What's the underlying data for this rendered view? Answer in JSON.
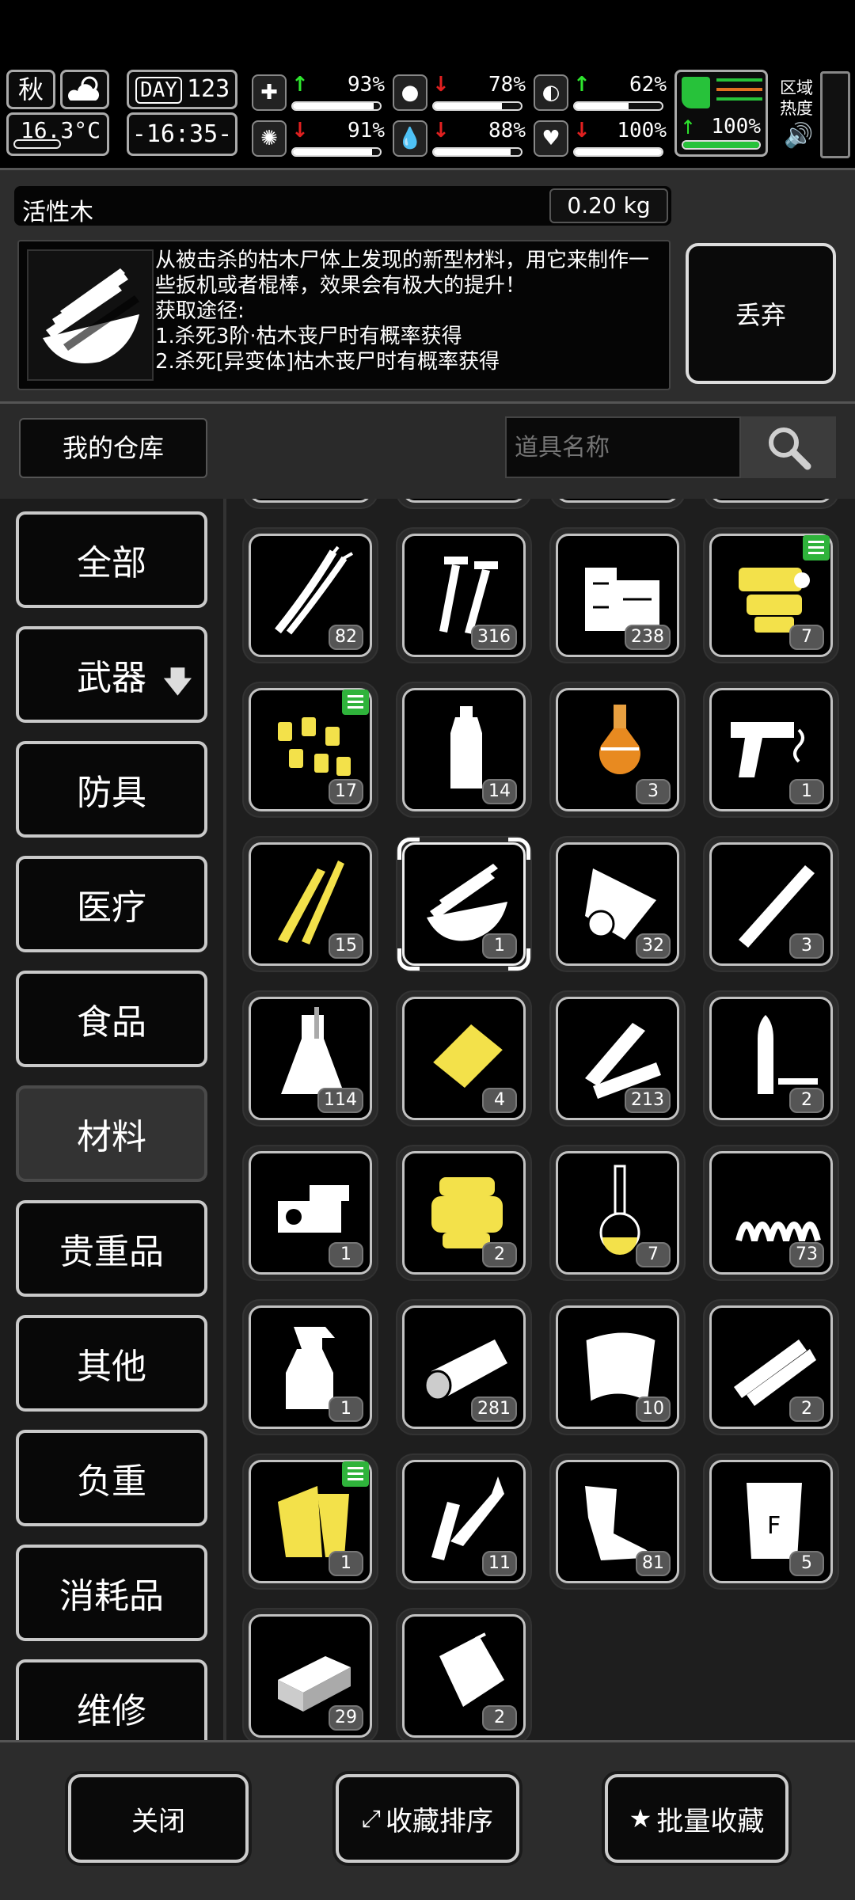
{
  "status": {
    "season": "秋",
    "temperature": "16.3°C",
    "day_label": "DAY",
    "day": "123",
    "time": "-16:35-",
    "stats": [
      {
        "icon": "medkit-icon",
        "glyph": "✚",
        "trend": "up",
        "value": "93%",
        "level": 0.93
      },
      {
        "icon": "stomach-icon",
        "glyph": "●",
        "trend": "down",
        "value": "78%",
        "level": 0.78
      },
      {
        "icon": "pill-icon",
        "glyph": "◐",
        "trend": "up",
        "value": "62%",
        "level": 0.62
      },
      {
        "icon": "brain-icon",
        "glyph": "✺",
        "trend": "down",
        "value": "91%",
        "level": 0.91
      },
      {
        "icon": "water-drop-icon",
        "glyph": "💧",
        "trend": "down",
        "value": "88%",
        "level": 0.88
      },
      {
        "icon": "heart-icon",
        "glyph": "♥",
        "trend": "down",
        "value": "100%",
        "level": 1.0
      }
    ],
    "stamina": {
      "icon": "boot-icon",
      "trend": "up",
      "value": "100%",
      "level": 1.0
    },
    "zone_label_1": "区域",
    "zone_label_2": "热度"
  },
  "item": {
    "name": "活性木",
    "weight": "0.20 kg",
    "description": "从被击杀的枯木尸体上发现的新型材料，用它来制作一些扳机或者棍棒，效果会有极大的提升！",
    "source_title": "获取途径:",
    "source_1": "1.杀死3阶·枯木丧尸时有概率获得",
    "source_2": "2.杀死[异变体]枯木丧尸时有概率获得",
    "discard_label": "丢弃"
  },
  "warehouse": {
    "title": "我的仓库",
    "search_placeholder": "道具名称"
  },
  "categories": [
    {
      "label": "全部",
      "active": false
    },
    {
      "label": "武器",
      "active": false,
      "arrow": true
    },
    {
      "label": "防具",
      "active": false
    },
    {
      "label": "医疗",
      "active": false
    },
    {
      "label": "食品",
      "active": false
    },
    {
      "label": "材料",
      "active": true
    },
    {
      "label": "贵重品",
      "active": false
    },
    {
      "label": "其他",
      "active": false
    },
    {
      "label": "负重",
      "active": false
    },
    {
      "label": "消耗品",
      "active": false
    },
    {
      "label": "维修",
      "active": false
    }
  ],
  "items": [
    {
      "icon": "wire-icon",
      "qty": "82",
      "fav": false,
      "yellow": false
    },
    {
      "icon": "screws-icon",
      "qty": "316",
      "fav": false,
      "yellow": false
    },
    {
      "icon": "wood-planks-icon",
      "qty": "238",
      "fav": false,
      "yellow": false
    },
    {
      "icon": "gold-parts-icon",
      "qty": "7",
      "fav": true,
      "yellow": true
    },
    {
      "icon": "gold-nuggets-icon",
      "qty": "17",
      "fav": true,
      "yellow": true
    },
    {
      "icon": "bottle-icon",
      "qty": "14",
      "fav": false,
      "yellow": false
    },
    {
      "icon": "flask-orange-icon",
      "qty": "3",
      "fav": false,
      "yellow": false
    },
    {
      "icon": "pistol-parts-icon",
      "qty": "1",
      "fav": false,
      "yellow": false
    },
    {
      "icon": "gold-sticks-icon",
      "qty": "15",
      "fav": false,
      "yellow": true
    },
    {
      "icon": "active-wood-icon",
      "qty": "1",
      "fav": false,
      "yellow": false,
      "selected": true
    },
    {
      "icon": "cloth-roll-icon",
      "qty": "32",
      "fav": false,
      "yellow": false
    },
    {
      "icon": "pipe-icon",
      "qty": "3",
      "fav": false,
      "yellow": false
    },
    {
      "icon": "beaker-icon",
      "qty": "114",
      "fav": false,
      "yellow": false
    },
    {
      "icon": "gold-plate-icon",
      "qty": "4",
      "fav": false,
      "yellow": true
    },
    {
      "icon": "timber-icon",
      "qty": "213",
      "fav": false,
      "yellow": false
    },
    {
      "icon": "bullet-casing-icon",
      "qty": "2",
      "fav": false,
      "yellow": false
    },
    {
      "icon": "trigger-mechanism-icon",
      "qty": "1",
      "fav": false,
      "yellow": false
    },
    {
      "icon": "gold-spool-icon",
      "qty": "2",
      "fav": false,
      "yellow": true
    },
    {
      "icon": "flask-yellow-icon",
      "qty": "7",
      "fav": false,
      "yellow": false
    },
    {
      "icon": "spring-icon",
      "qty": "73",
      "fav": false,
      "yellow": false
    },
    {
      "icon": "spray-bottle-icon",
      "qty": "1",
      "fav": false,
      "yellow": false
    },
    {
      "icon": "log-icon",
      "qty": "281",
      "fav": false,
      "yellow": false
    },
    {
      "icon": "sheet-icon",
      "qty": "10",
      "fav": false,
      "yellow": false
    },
    {
      "icon": "tubes-icon",
      "qty": "2",
      "fav": false,
      "yellow": false
    },
    {
      "icon": "gold-wood-icon",
      "qty": "1",
      "fav": true,
      "yellow": true
    },
    {
      "icon": "soldering-iron-icon",
      "qty": "11",
      "fav": false,
      "yellow": false
    },
    {
      "icon": "scrap-metal-icon",
      "qty": "81",
      "fav": false,
      "yellow": false
    },
    {
      "icon": "flour-bag-icon",
      "qty": "5",
      "fav": false,
      "yellow": false
    },
    {
      "icon": "brick-icon",
      "qty": "29",
      "fav": false,
      "yellow": false
    },
    {
      "icon": "plastic-bag-icon",
      "qty": "2",
      "fav": false,
      "yellow": false
    }
  ],
  "bottom": {
    "close_label": "关闭",
    "sort_label": "收藏排序",
    "batch_label": "批量收藏"
  },
  "colors": {
    "accent_green": "#2fb33b",
    "stat_up": "#2ee62e",
    "stat_down": "#e12020",
    "item_yellow": "#f3e14a"
  }
}
